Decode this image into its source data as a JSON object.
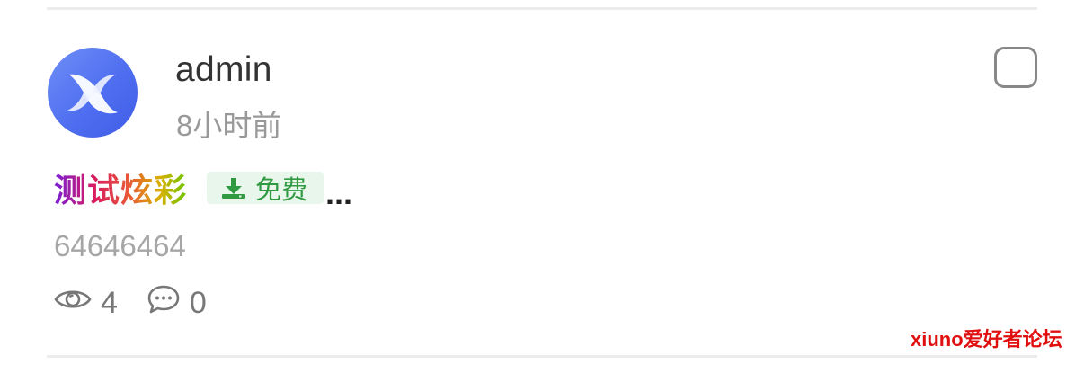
{
  "post": {
    "author": "admin",
    "time": "8小时前",
    "title": "测试炫彩",
    "badge": "免费",
    "ellipsis": "...",
    "excerpt": "64646464",
    "views": "4",
    "comments": "0"
  },
  "watermark": "xiuno爱好者论坛",
  "icons": {
    "avatar": "x-logo-avatar",
    "badge": "download-icon",
    "views": "eye-icon",
    "comments": "comment-icon",
    "select": "checkbox"
  },
  "colors": {
    "avatar_bg": "#5575f0",
    "badge_bg": "#e9f6ec",
    "badge_text": "#2f9a42",
    "muted_text": "#999999",
    "watermark": "#e01010"
  }
}
